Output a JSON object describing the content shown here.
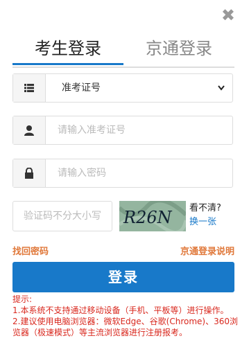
{
  "close": "✖",
  "tabs": [
    {
      "label": "考生登录"
    },
    {
      "label": "京通登录"
    }
  ],
  "select": {
    "value": "准考证号"
  },
  "fields": {
    "exam_id_placeholder": "请输入准考证号",
    "password_placeholder": "请输入密码",
    "captcha_placeholder": "验证码不分大小写"
  },
  "captcha": {
    "text": "R26N",
    "question": "看不清?",
    "refresh": "换一张"
  },
  "links": {
    "forgot": "找回密码",
    "jingtong_help": "京通登录说明"
  },
  "login_button": "登录",
  "tips": {
    "title": "提示:",
    "line1": "1.本系统不支持通过移动设备（手机、平板等）进行操作。",
    "line2": "2.建议使用电脑浏览器：微软Edge、谷歌(Chrome)、360浏览器（极速模式）等主流浏览器进行注册报考。"
  },
  "colors": {
    "accent": "#1879c9",
    "link": "#e0783a",
    "tip": "#d9281e"
  }
}
